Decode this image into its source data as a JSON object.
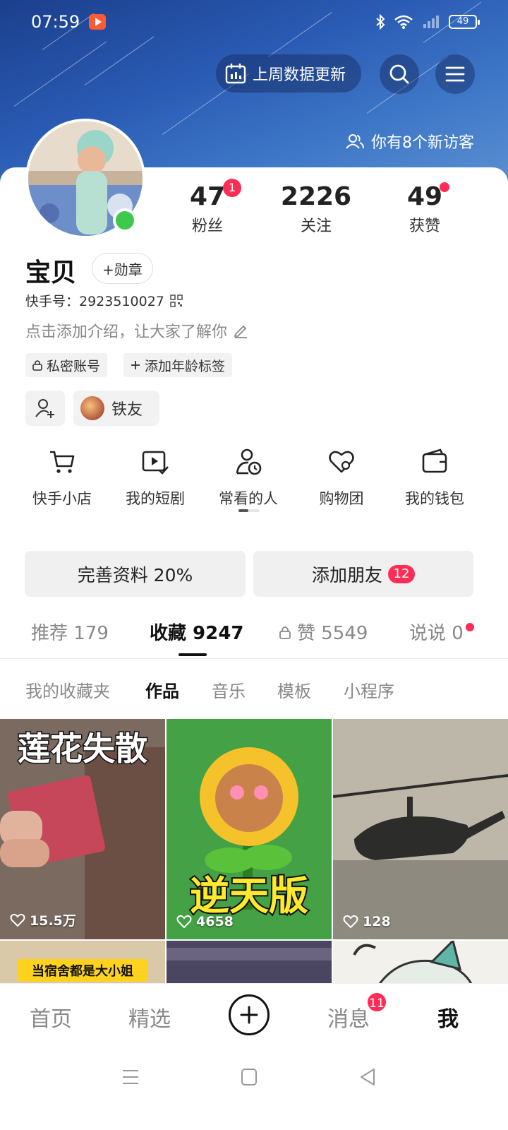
{
  "status_bar": {
    "time": "07:59",
    "battery": "49"
  },
  "header": {
    "data_update_label": "上周数据更新",
    "visitors_text": "你有8个新访客"
  },
  "stats": {
    "fans": {
      "value": "47",
      "label": "粉丝",
      "badge": "1"
    },
    "following": {
      "value": "2226",
      "label": "关注"
    },
    "likes": {
      "value": "49",
      "label": "获赞"
    }
  },
  "profile": {
    "name": "宝贝",
    "medal_label": "+勋章",
    "id_text": "快手号：2923510027",
    "bio_placeholder": "点击添加介绍，让大家了解你"
  },
  "tags": [
    {
      "label": "私密账号"
    },
    {
      "label": "添加年龄标签"
    }
  ],
  "friend_tag": "铁友",
  "services": [
    {
      "label": "快手小店",
      "icon": "cart-icon"
    },
    {
      "label": "我的短剧",
      "icon": "play-check-icon"
    },
    {
      "label": "常看的人",
      "icon": "user-clock-icon"
    },
    {
      "label": "购物团",
      "icon": "heart-group-icon"
    },
    {
      "label": "我的钱包",
      "icon": "wallet-icon"
    }
  ],
  "actions": {
    "complete_profile": "完善资料 20%",
    "add_friends": "添加朋友",
    "add_friends_badge": "12"
  },
  "content_tabs": [
    {
      "label": "推荐 179"
    },
    {
      "label": "收藏 9247"
    },
    {
      "label": "赞 5549"
    },
    {
      "label": "说说 0"
    }
  ],
  "sub_tabs": [
    {
      "label": "我的收藏夹"
    },
    {
      "label": "作品"
    },
    {
      "label": "音乐"
    },
    {
      "label": "模板"
    },
    {
      "label": "小程序"
    }
  ],
  "thumbnails": [
    {
      "overlay": "莲花失散",
      "likes": "15.5万"
    },
    {
      "overlay": "逆天版",
      "likes": "4658"
    },
    {
      "overlay": "",
      "likes": "128"
    }
  ],
  "thumbnails_row2": [
    {
      "overlay": "当宿舍都是大小姐"
    }
  ],
  "bottom_nav": {
    "home": "首页",
    "featured": "精选",
    "messages": "消息",
    "messages_badge": "11",
    "me": "我"
  },
  "colors": {
    "accent": "#ff2d55",
    "online": "#3ec84d"
  }
}
